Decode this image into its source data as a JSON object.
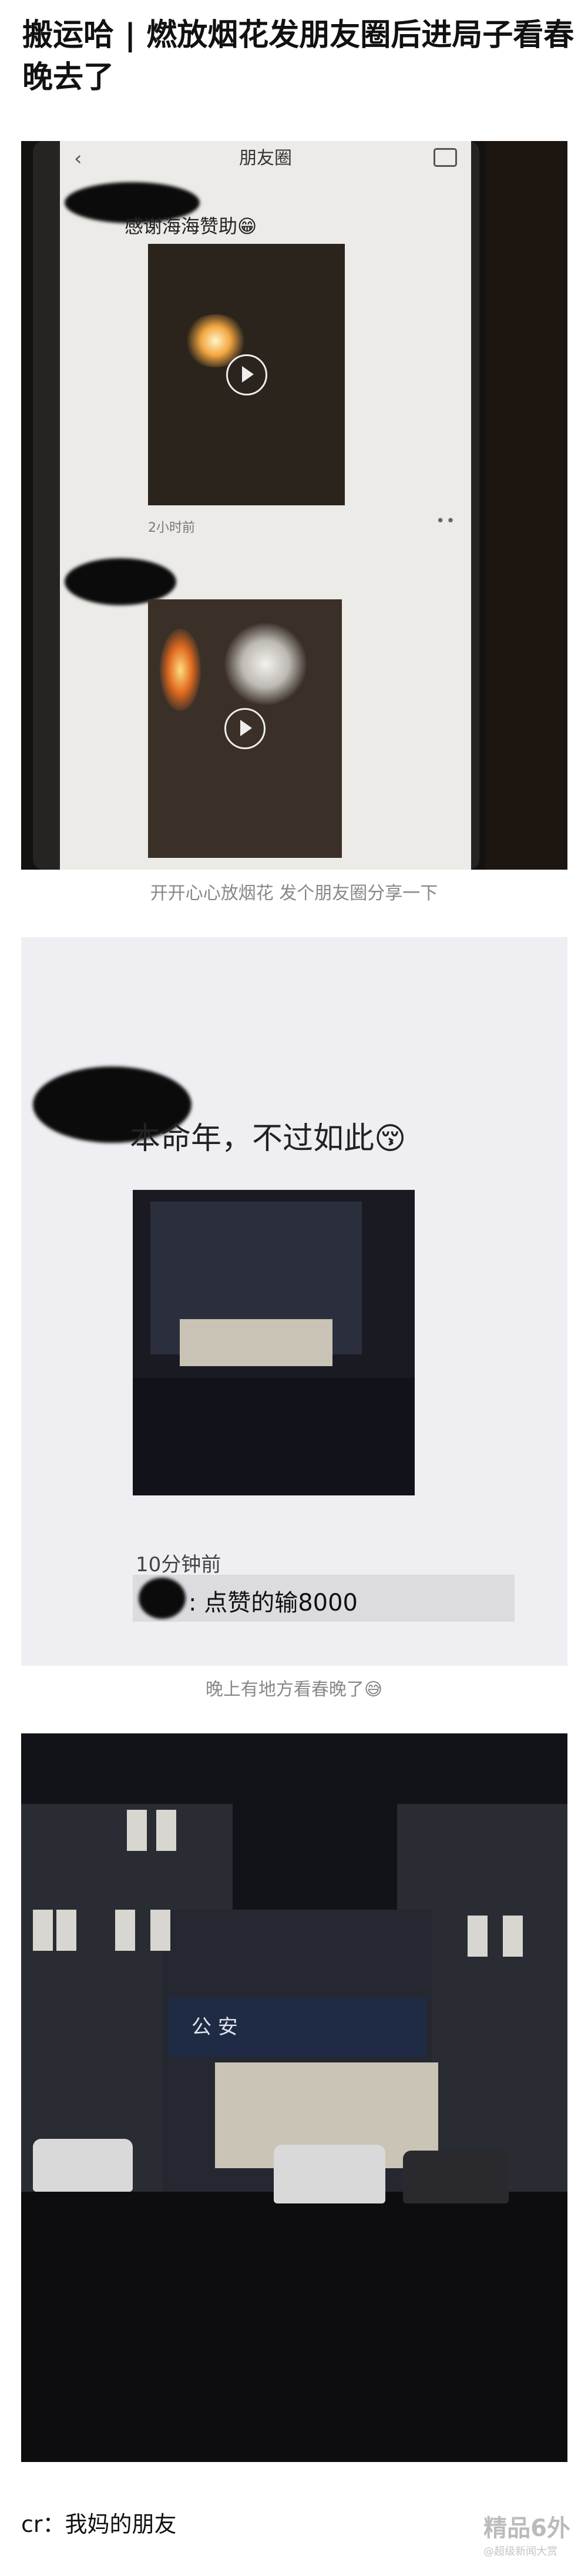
{
  "title": "搬运哈 | 燃放烟花发朋友圈后进局子看春晚去了",
  "photo1": {
    "topbar_title": "朋友圈",
    "back_glyph": "‹",
    "post1_text": "感谢海海赞助😁",
    "post1_time": "2小时前",
    "dots": "••",
    "caption": "开开心心放烟花 发个朋友圈分享一下"
  },
  "photo2": {
    "post_text": "本命年，不过如此😚",
    "post_time": "10分钟前",
    "comment": ": 点赞的输8000",
    "caption": "晚上有地方看春晚了😅"
  },
  "photo3": {
    "sign_text": "公 安"
  },
  "credit": "cr：我妈的朋友",
  "watermark": {
    "main": "精品6外",
    "sub": "@超级新闻大赏"
  }
}
